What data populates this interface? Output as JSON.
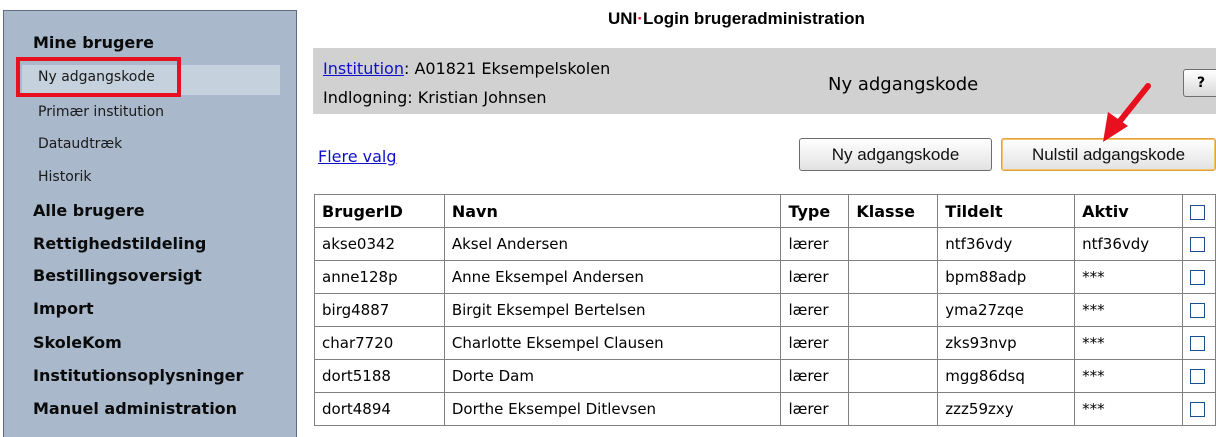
{
  "app": {
    "title_part1": "UNI",
    "title_dot": "·",
    "title_part2": "Login brugeradministration"
  },
  "sidebar": {
    "groups": [
      {
        "label": "Mine brugere"
      },
      {
        "label": "Alle brugere"
      },
      {
        "label": "Rettighedstildeling"
      },
      {
        "label": "Bestillingsoversigt"
      },
      {
        "label": "Import"
      },
      {
        "label": "SkoleKom"
      },
      {
        "label": "Institutionsoplysninger"
      },
      {
        "label": "Manuel administration"
      }
    ],
    "sub_items": [
      {
        "label": "Ny adgangskode",
        "selected": true
      },
      {
        "label": "Primær institution"
      },
      {
        "label": "Dataudtræk"
      },
      {
        "label": "Historik"
      }
    ]
  },
  "info": {
    "institution_label": "Institution",
    "institution_value": ": A01821 Eksempelskolen",
    "login_text": "Indlogning: Kristian Johnsen",
    "page_heading": "Ny adgangskode",
    "help_label": "?"
  },
  "actions": {
    "more_options": "Flere valg",
    "new_password": "Ny adgangskode",
    "reset_password": "Nulstil adgangskode"
  },
  "table": {
    "headers": [
      "BrugerID",
      "Navn",
      "Type",
      "Klasse",
      "Tildelt",
      "Aktiv"
    ],
    "rows": [
      {
        "id": "akse0342",
        "name": "Aksel Andersen",
        "type": "lærer",
        "class": "",
        "assigned": "ntf36vdy",
        "active": "ntf36vdy"
      },
      {
        "id": "anne128p",
        "name": "Anne Eksempel Andersen",
        "type": "lærer",
        "class": "",
        "assigned": "bpm88adp",
        "active": "***"
      },
      {
        "id": "birg4887",
        "name": "Birgit Eksempel Bertelsen",
        "type": "lærer",
        "class": "",
        "assigned": "yma27zqe",
        "active": "***"
      },
      {
        "id": "char7720",
        "name": "Charlotte Eksempel Clausen",
        "type": "lærer",
        "class": "",
        "assigned": "zks93nvp",
        "active": "***"
      },
      {
        "id": "dort5188",
        "name": "Dorte Dam",
        "type": "lærer",
        "class": "",
        "assigned": "mgg86dsq",
        "active": "***"
      },
      {
        "id": "dort4894",
        "name": "Dorthe Eksempel Ditlevsen",
        "type": "lærer",
        "class": "",
        "assigned": "zzz59zxy",
        "active": "***"
      }
    ]
  },
  "colors": {
    "sidebar_bg": "#a9b9cb",
    "highlight": "#e8101e",
    "link": "#1010cc",
    "infobar_bg": "#d1d1d1"
  }
}
